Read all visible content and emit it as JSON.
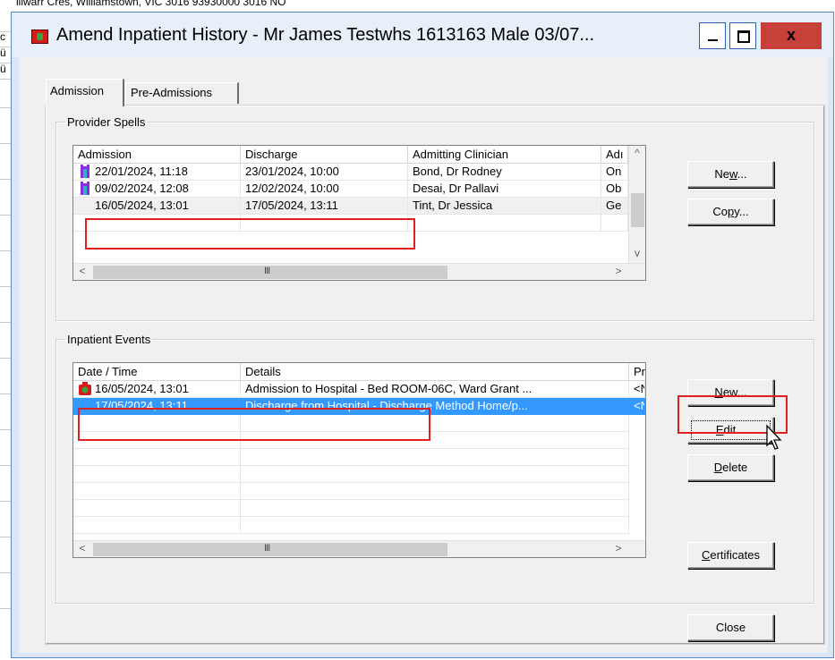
{
  "background": {
    "strip_text": "illwarr Cres, Williamstown, VIC 3016          93930000                                                                          3016          NO",
    "left_marks": [
      "c",
      "ü",
      "ü"
    ]
  },
  "window": {
    "title": "Amend Inpatient History - Mr James Testwhs 1613163 Male 03/07...",
    "close_glyph": "x"
  },
  "tabs": [
    {
      "label": "Admission",
      "active": true
    },
    {
      "label": "Pre-Admissions",
      "active": false
    }
  ],
  "provider_spells": {
    "legend": "Provider Spells",
    "columns": [
      "Admission",
      "Discharge",
      "Admitting Clinician",
      "Adı"
    ],
    "rows": [
      {
        "admission": "22/01/2024, 11:18",
        "discharge": "23/01/2024, 10:00",
        "clinician": "Bond, Dr Rodney",
        "adm": "On"
      },
      {
        "admission": "09/02/2024, 12:08",
        "discharge": "12/02/2024, 10:00",
        "clinician": "Desai, Dr Pallavi",
        "adm": "Ob"
      },
      {
        "admission": "16/05/2024, 13:01",
        "discharge": "17/05/2024, 13:11",
        "clinician": "Tint, Dr Jessica",
        "adm": "Ge"
      }
    ],
    "buttons": {
      "new": "New...",
      "copy": "Copy..."
    }
  },
  "inpatient_events": {
    "legend": "Inpatient Events",
    "columns": [
      "Date / Time",
      "Details",
      "Pr"
    ],
    "rows": [
      {
        "datetime": "16/05/2024, 13:01",
        "details": "Admission to Hospital - Bed ROOM-06C, Ward Grant ...",
        "pr": "<N"
      },
      {
        "datetime": "17/05/2024, 13:11",
        "details": "Discharge from Hospital - Discharge Method Home/p...",
        "pr": "<N"
      }
    ],
    "buttons": {
      "new": "New...",
      "edit": "Edit...",
      "delete": "Delete",
      "certificates": "Certificates"
    }
  },
  "footer": {
    "close": "Close"
  },
  "scroll": {
    "grip": "III",
    "left": "<",
    "right": ">",
    "up": "^",
    "down": "v"
  },
  "colors": {
    "highlight": "#e02020",
    "selection": "#3399ff",
    "title_bg": "#e7eff9",
    "close_btn": "#c8403a"
  }
}
